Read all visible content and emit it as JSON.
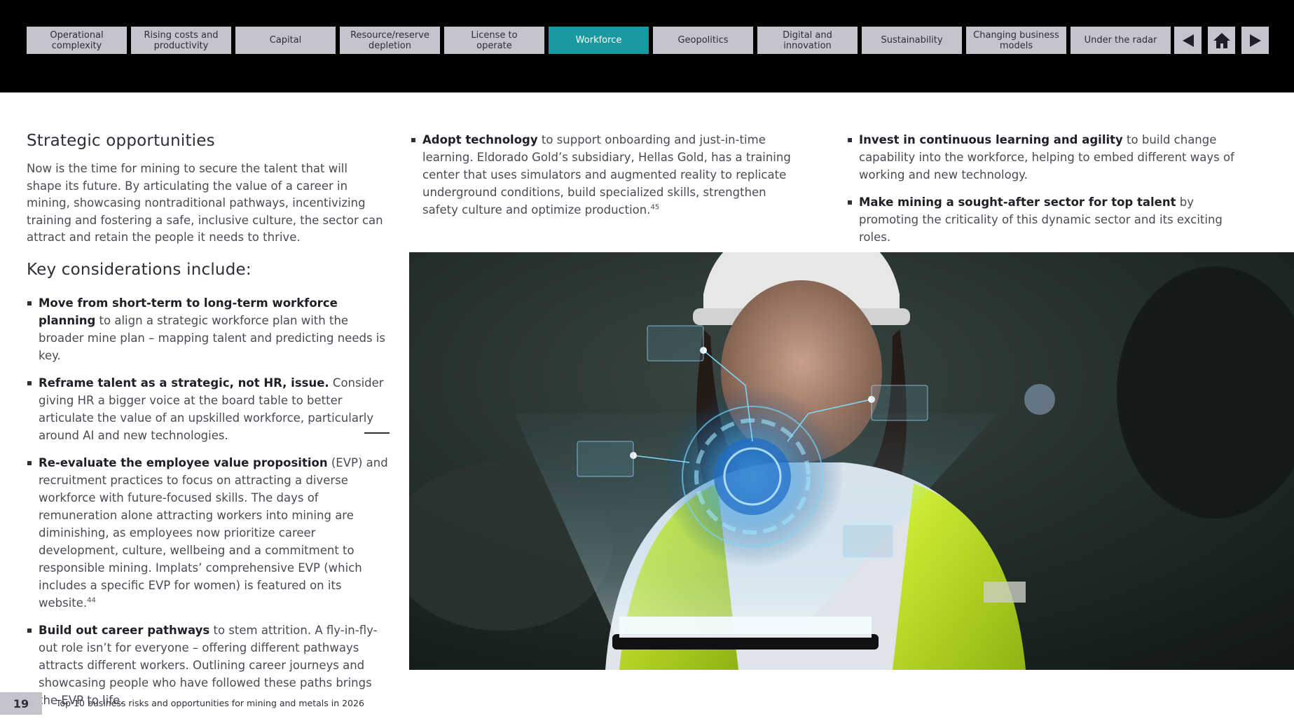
{
  "nav": {
    "tabs": [
      {
        "label": "Operational\ncomplexity",
        "active": false
      },
      {
        "label": "Rising costs and\nproductivity",
        "active": false
      },
      {
        "label": "Capital",
        "active": false
      },
      {
        "label": "Resource/reserve\ndepletion",
        "active": false
      },
      {
        "label": "License to\noperate",
        "active": false
      },
      {
        "label": "Workforce",
        "active": true
      },
      {
        "label": "Geopolitics",
        "active": false
      },
      {
        "label": "Digital and\ninnovation",
        "active": false
      },
      {
        "label": "Sustainability",
        "active": false
      },
      {
        "label": "Changing business\nmodels",
        "active": false
      },
      {
        "label": "Under the radar",
        "active": false
      }
    ],
    "prev_icon": "triangle-left-icon",
    "home_icon": "home-icon",
    "next_icon": "triangle-right-icon",
    "active_color": "#1a9aa0",
    "tab_color": "#c4c4cd"
  },
  "strategic": {
    "heading": "Strategic opportunities",
    "body": "Now is the time for mining to secure the talent that will shape its future. By articulating the value of a career in mining, showcasing nontraditional pathways, incentivizing training and fostering a safe, inclusive culture, the sector can attract and retain the people it needs to thrive."
  },
  "key": {
    "heading": "Key considerations include:",
    "items": [
      {
        "bold": "Move from short-term to long-term workforce planning",
        "text": " to align a strategic workforce plan with the broader mine plan – mapping talent and predicting needs is key.",
        "sup": ""
      },
      {
        "bold": "Reframe talent as a strategic, not HR, issue.",
        "text": " Consider giving HR a bigger voice at the board table to better articulate the value of an upskilled workforce, particularly around AI and new technologies.",
        "sup": ""
      },
      {
        "bold": "Re-evaluate the employee value proposition",
        "text": " (EVP) and recruitment practices to focus on attracting a diverse workforce with future-focused skills. The days of remuneration alone attracting workers into mining are diminishing, as employees now prioritize career development, culture, wellbeing and a commitment to responsible mining. Implats’ comprehensive EVP (which includes a specific EVP for women) is featured on its website.",
        "sup": "44"
      },
      {
        "bold": "Build out career pathways",
        "text": " to stem attrition. A fly-in-fly-out role isn’t for everyone – offering different pathways attracts different workers. Outlining career journeys and showcasing people who have followed these paths brings the EVP to life.",
        "sup": ""
      }
    ]
  },
  "middle": {
    "items": [
      {
        "bold": "Adopt technology",
        "text": " to support onboarding and just-in-time learning. Eldorado Gold’s subsidiary, Hellas Gold, has a training center that uses simulators and augmented reality to replicate underground conditions, build specialized skills, strengthen safety culture and optimize production.",
        "sup": "45"
      }
    ]
  },
  "right": {
    "items": [
      {
        "bold": "Invest in continuous learning and agility",
        "text": " to build change capability into the workforce, helping to embed different ways of working and new technology.",
        "sup": ""
      },
      {
        "bold": "Make mining a sought-after sector for top talent",
        "text": " by promoting the criticality of this dynamic sector and its exciting roles.",
        "sup": ""
      }
    ]
  },
  "footer": {
    "page_number": "19",
    "title": "Top 10 business risks and opportunities for mining and metals in 2026"
  }
}
